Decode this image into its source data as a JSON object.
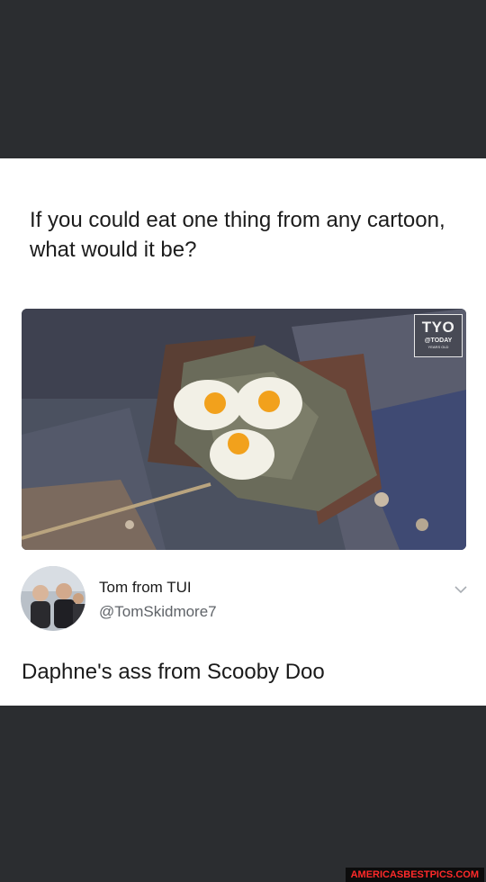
{
  "post": {
    "question": "If you could eat one thing from any cartoon, what would it be?"
  },
  "photo": {
    "badge_logo": "TYO",
    "badge_sub": "@TODAY",
    "badge_sub2": "YEARS OLD"
  },
  "reply": {
    "author_name": "Tom from TUI",
    "author_handle": "@TomSkidmore7",
    "text": "Daphne's ass from Scooby Doo"
  },
  "watermark": {
    "text": "AMERICASBESTPICS.COM"
  },
  "colors": {
    "background": "#2b2d30",
    "card": "#ffffff",
    "watermark_text": "#ff2a2a"
  }
}
